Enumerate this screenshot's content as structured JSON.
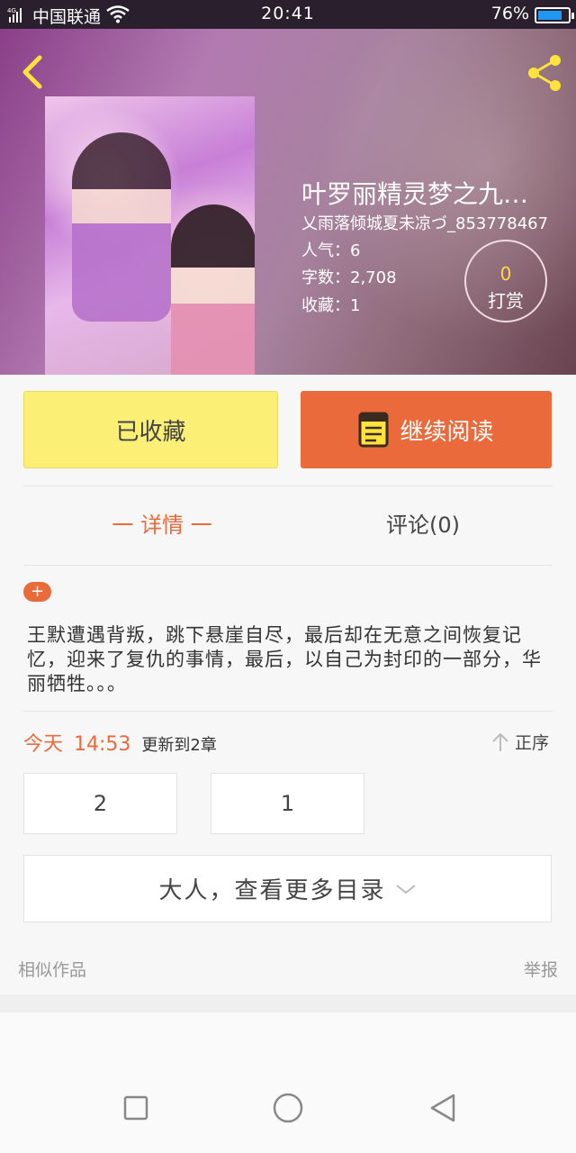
{
  "status_bar": {
    "network": "4G",
    "carrier": "中国联通",
    "time": "20:41",
    "battery": "76%",
    "battery_level": 0.76,
    "battery_color": "#2196f3"
  },
  "header": {
    "back_icon": "chevron-left-icon",
    "share_icon": "share-icon",
    "title": "叶罗丽精灵梦之九…",
    "author": "乂雨落倾城夏未凉づ_853778467",
    "popularity": "人气：6",
    "word_count": "字数：2,708",
    "favorites": "收藏：1",
    "reward_count": "0",
    "reward_label": "打赏"
  },
  "actions": {
    "collected_label": "已收藏",
    "continue_label": "继续阅读",
    "continue_icon": "book-icon",
    "accent": "#ea6a3c",
    "collected_bg": "#fbef76"
  },
  "tabs": {
    "detail": "一 详情 一",
    "comments": "评论(0)"
  },
  "detail": {
    "expand_badge": "+",
    "description": "王默遭遇背叛，跳下悬崖自尽，最后却在无意之间恢复记忆，迎来了复仇的事情，最后，以自己为封印的一部分，华丽牺牲。。。"
  },
  "update": {
    "day": "今天",
    "time": "14:53",
    "text": "更新到2章",
    "sort_label": "正序",
    "sort_icon": "arrow-up-icon"
  },
  "chapters": [
    "2",
    "1"
  ],
  "more_catalog": {
    "label": "大人，查看更多目录",
    "icon": "chevron-down-icon"
  },
  "footer": {
    "similar": "相似作品",
    "report": "举报"
  },
  "nav": {
    "recent_icon": "square-icon",
    "home_icon": "circle-icon",
    "back_icon": "triangle-back-icon"
  }
}
